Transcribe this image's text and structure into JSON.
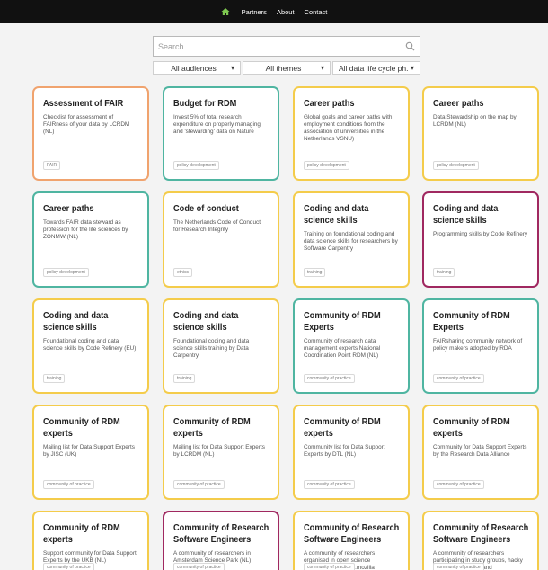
{
  "nav": {
    "partners": "Partners",
    "about": "About",
    "contact": "Contact"
  },
  "search": {
    "placeholder": "Search"
  },
  "filters": {
    "audiences": "All audiences",
    "themes": "All themes",
    "lifecycle": "All data life cycle ph..."
  },
  "colors": {
    "orange": "#f0a36e",
    "teal": "#4fb5a1",
    "yellow": "#f4cc4b",
    "purple": "#a02860"
  },
  "cards": [
    {
      "title": "Assessment of FAIR",
      "desc": "Checklist for assessment of FAIRness of your data by LCRDM (NL)",
      "tag": "FAIR",
      "color": "orange"
    },
    {
      "title": "Budget for RDM",
      "desc": "Invest 5% of total research expenditure on properly managing and 'stewarding' data on Nature",
      "tag": "policy development",
      "color": "teal"
    },
    {
      "title": "Career paths",
      "desc": "Global goals and career paths with employment conditions from the association of universities in the Netherlands VSNU)",
      "tag": "policy development",
      "color": "yellow"
    },
    {
      "title": "Career paths",
      "desc": "Data Stewardship on the map by LCRDM (NL)",
      "tag": "policy development",
      "color": "yellow"
    },
    {
      "title": "Career paths",
      "desc": "Towards FAIR data steward as profession for the life sciences by ZONMW (NL)",
      "tag": "policy development",
      "color": "teal"
    },
    {
      "title": "Code of conduct",
      "desc": "The Netherlands Code of Conduct for Research Integrity",
      "tag": "ethics",
      "color": "yellow"
    },
    {
      "title": "Coding and data science skills",
      "desc": "Training on foundational coding and data science skills for researchers by Software Carpentry",
      "tag": "training",
      "color": "yellow"
    },
    {
      "title": "Coding and data science skills",
      "desc": "Programming skills by Code Refinery",
      "tag": "training",
      "color": "purple"
    },
    {
      "title": "Coding and data science skills",
      "desc": "Foundational coding and data science skills by Code Refinery (EU)",
      "tag": "training",
      "color": "yellow"
    },
    {
      "title": "Coding and data science skills",
      "desc": "Foundational coding and data science skills training by Data Carpentry",
      "tag": "training",
      "color": "yellow"
    },
    {
      "title": "Community of RDM Experts",
      "desc": "Community of research data management experts National Coordination Point RDM (NL)",
      "tag": "community of practice",
      "color": "teal"
    },
    {
      "title": "Community of RDM Experts",
      "desc": "FAIRsharing community network of policy makers adopted by RDA",
      "tag": "community of practice",
      "color": "teal"
    },
    {
      "title": "Community of RDM experts",
      "desc": "Mailing list for Data Support Experts by JISC (UK)",
      "tag": "community of practice",
      "color": "yellow"
    },
    {
      "title": "Community of RDM experts",
      "desc": "Mailing list for Data Support Experts by LCRDM (NL)",
      "tag": "community of practice",
      "color": "yellow"
    },
    {
      "title": "Community of RDM experts",
      "desc": "Community list for Data Support Experts by DTL (NL)",
      "tag": "community of practice",
      "color": "yellow"
    },
    {
      "title": "Community of RDM experts",
      "desc": "Community for Data Support Experts by the Research Data Alliance",
      "tag": "community of practice",
      "color": "yellow"
    },
    {
      "title": "Community of RDM experts",
      "desc": "Support community for Data Support Experts by the UKB (NL)",
      "tag": "community of practice",
      "color": "yellow"
    },
    {
      "title": "Community of Research Software Engineers",
      "desc": "A community of researchers in Amsterdam Science Park (NL)",
      "tag": "community of practice",
      "color": "purple"
    },
    {
      "title": "Community of Research Software Engineers",
      "desc": "A community of researchers organised in open science communities on wiki.mozilla",
      "tag": "community of practice",
      "color": "yellow"
    },
    {
      "title": "Community of Research Software Engineers",
      "desc": "A community of researchers participating in study groups, hacky hours coding clubs and",
      "tag": "community of practice",
      "color": "yellow"
    }
  ]
}
